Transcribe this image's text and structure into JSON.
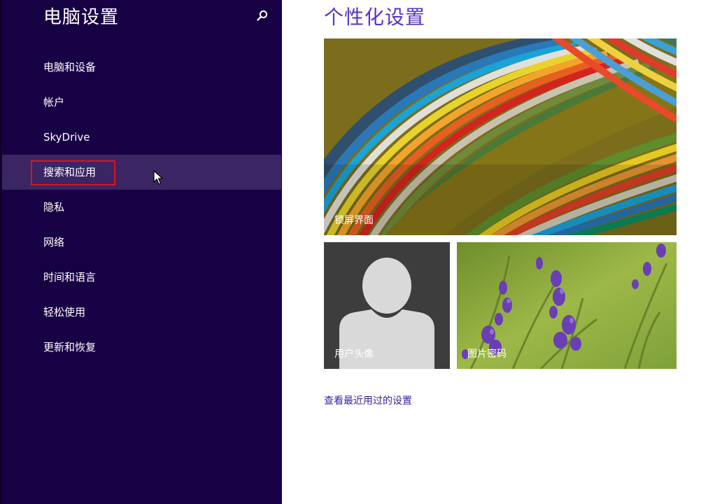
{
  "sidebar": {
    "title": "电脑设置",
    "search_icon": "search-icon",
    "items": [
      {
        "label": "电脑和设备"
      },
      {
        "label": "帐户"
      },
      {
        "label": "SkyDrive"
      },
      {
        "label": "搜索和应用",
        "selected": true
      },
      {
        "label": "隐私"
      },
      {
        "label": "网络"
      },
      {
        "label": "时间和语言"
      },
      {
        "label": "轻松使用"
      },
      {
        "label": "更新和恢复"
      }
    ]
  },
  "main": {
    "title": "个性化设置",
    "tiles": {
      "lock_screen": {
        "label": "锁屏界面"
      },
      "account_picture": {
        "label": "用户头像",
        "icon": "user-silhouette-icon"
      },
      "picture_password": {
        "label": "图片密码"
      }
    },
    "recent_link": "查看最近用过的设置"
  },
  "colors": {
    "sidebar_bg": "#180045",
    "selected_bg": "#3b2563",
    "accent": "#5733c9",
    "highlight": "#e3101e"
  }
}
